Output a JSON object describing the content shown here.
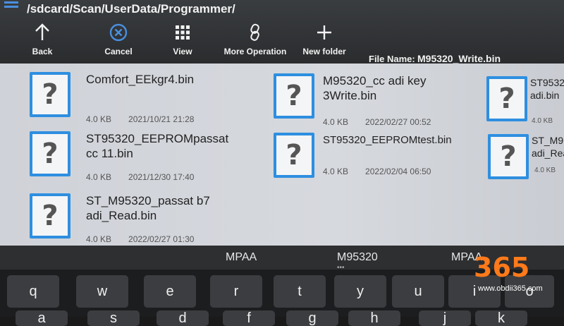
{
  "path": "/sdcard/Scan/UserData/Programmer/",
  "toolbar": {
    "back": "Back",
    "cancel": "Cancel",
    "view": "View",
    "more_operation": "More Operation",
    "new_folder": "New folder",
    "file_name_label": "File Name:",
    "file_name_value": "M95320_Write.bin"
  },
  "files": [
    {
      "name": "Comfort_EEkgr4.bin",
      "size": "4.0 KB",
      "date": "2021/10/21 21:28"
    },
    {
      "name": "M95320_cc adi key 3Write.bin",
      "size": "4.0 KB",
      "date": "2022/02/27 00:52"
    },
    {
      "name": "ST9532 adi.bin",
      "size": "4.0 KB",
      "date": ""
    },
    {
      "name": "ST95320_EEPROMpassat cc 11.bin",
      "size": "4.0 KB",
      "date": "2021/12/30 17:40"
    },
    {
      "name": "ST95320_EEPROMtest.bin",
      "size": "4.0 KB",
      "date": "2022/02/04 06:50"
    },
    {
      "name": "ST_M9 adi_Rea",
      "size": "4.0 KB",
      "date": ""
    },
    {
      "name": "ST_M95320_passat b7 adi_Read.bin",
      "size": "4.0 KB",
      "date": "2022/02/27 01:30"
    }
  ],
  "suggestions": [
    "MPAA",
    "M95320",
    "MPAA"
  ],
  "keys_row1": [
    "q",
    "w",
    "e",
    "r",
    "t",
    "y",
    "u",
    "i",
    "o"
  ],
  "keys_row2": [
    "a",
    "s",
    "d",
    "f",
    "g",
    "h",
    "j",
    "k"
  ],
  "watermark": {
    "logo": "365",
    "url": "www.obdii365.com"
  },
  "colors": {
    "accent": "#2e8fe0",
    "brand": "#ff7a1a"
  }
}
